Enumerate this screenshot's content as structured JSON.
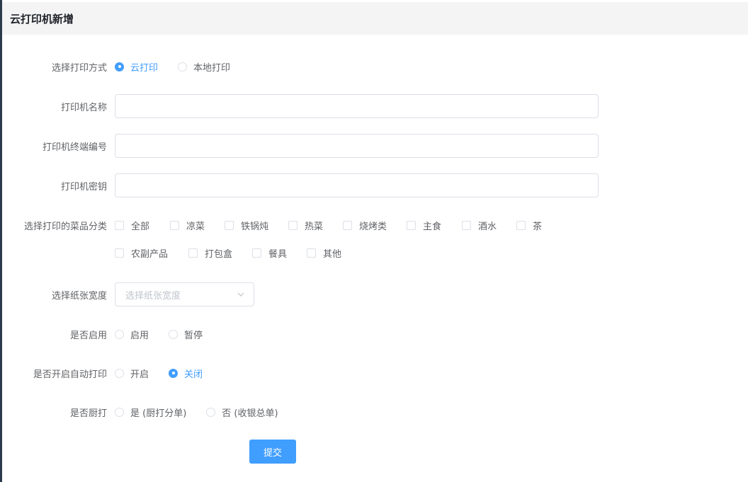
{
  "header": {
    "title": "云打印机新增"
  },
  "print_mode": {
    "label": "选择打印方式",
    "options": [
      {
        "label": "云打印",
        "checked": true
      },
      {
        "label": "本地打印",
        "checked": false
      }
    ]
  },
  "printer_name": {
    "label": "打印机名称",
    "value": ""
  },
  "terminal_no": {
    "label": "打印机终端编号",
    "value": ""
  },
  "printer_key": {
    "label": "打印机密钥",
    "value": ""
  },
  "categories": {
    "label": "选择打印的菜品分类",
    "items": [
      "全部",
      "凉菜",
      "铁锅炖",
      "热菜",
      "烧烤类",
      "主食",
      "酒水",
      "茶",
      "农副产品",
      "打包盒",
      "餐具",
      "其他"
    ]
  },
  "paper_width": {
    "label": "选择纸张宽度",
    "placeholder": "选择纸张宽度"
  },
  "enabled": {
    "label": "是否启用",
    "options": [
      {
        "label": "启用",
        "checked": false
      },
      {
        "label": "暂停",
        "checked": false
      }
    ]
  },
  "auto_print": {
    "label": "是否开启自动打印",
    "options": [
      {
        "label": "开启",
        "checked": false
      },
      {
        "label": "关闭",
        "checked": true
      }
    ]
  },
  "kitchen_print": {
    "label": "是否厨打",
    "options": [
      {
        "label": "是 (厨打分单)",
        "checked": false
      },
      {
        "label": "否 (收银总单)",
        "checked": false
      }
    ]
  },
  "submit": {
    "label": "提交"
  },
  "colors": {
    "primary": "#409eff",
    "header_bg": "#f4f4f5",
    "border": "#dcdfe6",
    "placeholder": "#c0c4cc"
  },
  "icons": {
    "select_arrow": "chevron-down-icon"
  }
}
